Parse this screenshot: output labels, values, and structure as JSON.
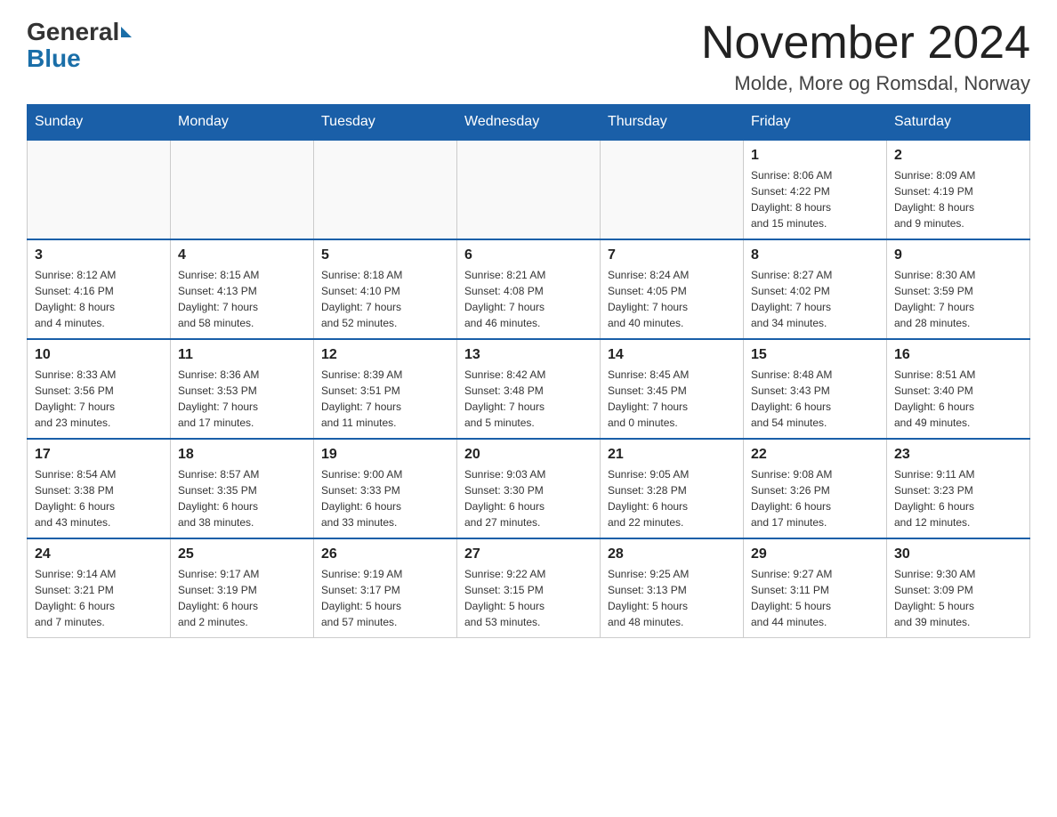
{
  "logo": {
    "general": "General",
    "blue": "Blue"
  },
  "title": "November 2024",
  "location": "Molde, More og Romsdal, Norway",
  "weekdays": [
    "Sunday",
    "Monday",
    "Tuesday",
    "Wednesday",
    "Thursday",
    "Friday",
    "Saturday"
  ],
  "weeks": [
    [
      {
        "day": "",
        "info": ""
      },
      {
        "day": "",
        "info": ""
      },
      {
        "day": "",
        "info": ""
      },
      {
        "day": "",
        "info": ""
      },
      {
        "day": "",
        "info": ""
      },
      {
        "day": "1",
        "info": "Sunrise: 8:06 AM\nSunset: 4:22 PM\nDaylight: 8 hours\nand 15 minutes."
      },
      {
        "day": "2",
        "info": "Sunrise: 8:09 AM\nSunset: 4:19 PM\nDaylight: 8 hours\nand 9 minutes."
      }
    ],
    [
      {
        "day": "3",
        "info": "Sunrise: 8:12 AM\nSunset: 4:16 PM\nDaylight: 8 hours\nand 4 minutes."
      },
      {
        "day": "4",
        "info": "Sunrise: 8:15 AM\nSunset: 4:13 PM\nDaylight: 7 hours\nand 58 minutes."
      },
      {
        "day": "5",
        "info": "Sunrise: 8:18 AM\nSunset: 4:10 PM\nDaylight: 7 hours\nand 52 minutes."
      },
      {
        "day": "6",
        "info": "Sunrise: 8:21 AM\nSunset: 4:08 PM\nDaylight: 7 hours\nand 46 minutes."
      },
      {
        "day": "7",
        "info": "Sunrise: 8:24 AM\nSunset: 4:05 PM\nDaylight: 7 hours\nand 40 minutes."
      },
      {
        "day": "8",
        "info": "Sunrise: 8:27 AM\nSunset: 4:02 PM\nDaylight: 7 hours\nand 34 minutes."
      },
      {
        "day": "9",
        "info": "Sunrise: 8:30 AM\nSunset: 3:59 PM\nDaylight: 7 hours\nand 28 minutes."
      }
    ],
    [
      {
        "day": "10",
        "info": "Sunrise: 8:33 AM\nSunset: 3:56 PM\nDaylight: 7 hours\nand 23 minutes."
      },
      {
        "day": "11",
        "info": "Sunrise: 8:36 AM\nSunset: 3:53 PM\nDaylight: 7 hours\nand 17 minutes."
      },
      {
        "day": "12",
        "info": "Sunrise: 8:39 AM\nSunset: 3:51 PM\nDaylight: 7 hours\nand 11 minutes."
      },
      {
        "day": "13",
        "info": "Sunrise: 8:42 AM\nSunset: 3:48 PM\nDaylight: 7 hours\nand 5 minutes."
      },
      {
        "day": "14",
        "info": "Sunrise: 8:45 AM\nSunset: 3:45 PM\nDaylight: 7 hours\nand 0 minutes."
      },
      {
        "day": "15",
        "info": "Sunrise: 8:48 AM\nSunset: 3:43 PM\nDaylight: 6 hours\nand 54 minutes."
      },
      {
        "day": "16",
        "info": "Sunrise: 8:51 AM\nSunset: 3:40 PM\nDaylight: 6 hours\nand 49 minutes."
      }
    ],
    [
      {
        "day": "17",
        "info": "Sunrise: 8:54 AM\nSunset: 3:38 PM\nDaylight: 6 hours\nand 43 minutes."
      },
      {
        "day": "18",
        "info": "Sunrise: 8:57 AM\nSunset: 3:35 PM\nDaylight: 6 hours\nand 38 minutes."
      },
      {
        "day": "19",
        "info": "Sunrise: 9:00 AM\nSunset: 3:33 PM\nDaylight: 6 hours\nand 33 minutes."
      },
      {
        "day": "20",
        "info": "Sunrise: 9:03 AM\nSunset: 3:30 PM\nDaylight: 6 hours\nand 27 minutes."
      },
      {
        "day": "21",
        "info": "Sunrise: 9:05 AM\nSunset: 3:28 PM\nDaylight: 6 hours\nand 22 minutes."
      },
      {
        "day": "22",
        "info": "Sunrise: 9:08 AM\nSunset: 3:26 PM\nDaylight: 6 hours\nand 17 minutes."
      },
      {
        "day": "23",
        "info": "Sunrise: 9:11 AM\nSunset: 3:23 PM\nDaylight: 6 hours\nand 12 minutes."
      }
    ],
    [
      {
        "day": "24",
        "info": "Sunrise: 9:14 AM\nSunset: 3:21 PM\nDaylight: 6 hours\nand 7 minutes."
      },
      {
        "day": "25",
        "info": "Sunrise: 9:17 AM\nSunset: 3:19 PM\nDaylight: 6 hours\nand 2 minutes."
      },
      {
        "day": "26",
        "info": "Sunrise: 9:19 AM\nSunset: 3:17 PM\nDaylight: 5 hours\nand 57 minutes."
      },
      {
        "day": "27",
        "info": "Sunrise: 9:22 AM\nSunset: 3:15 PM\nDaylight: 5 hours\nand 53 minutes."
      },
      {
        "day": "28",
        "info": "Sunrise: 9:25 AM\nSunset: 3:13 PM\nDaylight: 5 hours\nand 48 minutes."
      },
      {
        "day": "29",
        "info": "Sunrise: 9:27 AM\nSunset: 3:11 PM\nDaylight: 5 hours\nand 44 minutes."
      },
      {
        "day": "30",
        "info": "Sunrise: 9:30 AM\nSunset: 3:09 PM\nDaylight: 5 hours\nand 39 minutes."
      }
    ]
  ]
}
